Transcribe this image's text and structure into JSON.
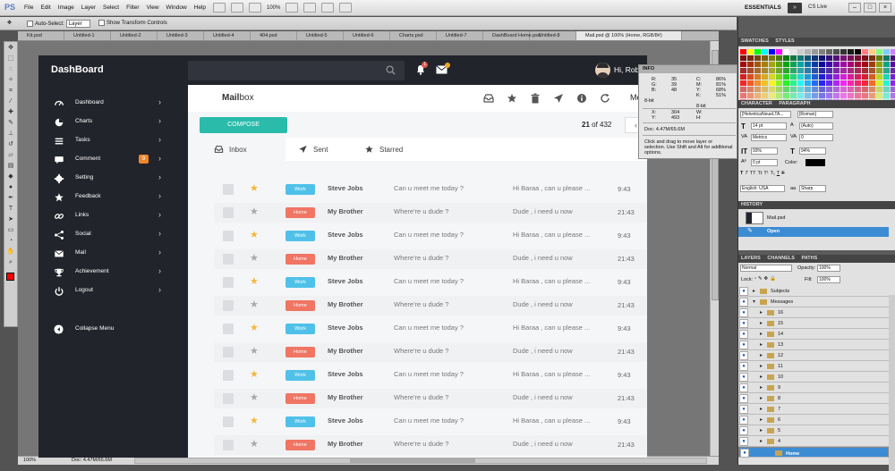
{
  "photoshop": {
    "logo": "PS",
    "menu": [
      "File",
      "Edit",
      "Image",
      "Layer",
      "Select",
      "Filter",
      "View",
      "Window",
      "Help"
    ],
    "zoom": "100%",
    "workspace": "ESSENTIALS",
    "cs_live": "CS Live",
    "options": {
      "auto_select": "Auto-Select:",
      "auto_select_value": "Layer",
      "transform": "Show Transform Controls"
    },
    "tabs": [
      "Kit.psd",
      "Untitled-1",
      "Untitled-2",
      "Untitled-3",
      "Untitled-4",
      "404.psd",
      "Untitled-5",
      "Untitled-6",
      "Charts.psd",
      "Untitled-7",
      "DashBoard Home.psd",
      "Untitled-8",
      "Mail.psd @ 100% (Home, RGB/8#)"
    ],
    "status": {
      "zoom": "100%",
      "doc": "Doc: 4.47M/65.6M"
    },
    "colors": {
      "foreground": "#ff0000",
      "background": "#ffffff",
      "accent": "#3c8cd4"
    }
  },
  "info_panel": {
    "title": "INFO",
    "rgb": [
      {
        "k": "R:",
        "v": "35"
      },
      {
        "k": "G:",
        "v": "39"
      },
      {
        "k": "B:",
        "v": "48"
      }
    ],
    "cmyk": [
      {
        "k": "C:",
        "v": "86%"
      },
      {
        "k": "M:",
        "v": "81%"
      },
      {
        "k": "Y:",
        "v": "68%"
      },
      {
        "k": "K:",
        "v": "51%"
      }
    ],
    "bit_left": "8-bit",
    "bit_right": "8-bit",
    "xy": [
      {
        "k": "X:",
        "v": "304"
      },
      {
        "k": "Y:",
        "v": "493"
      }
    ],
    "wh": [
      {
        "k": "W:",
        "v": ""
      },
      {
        "k": "H:",
        "v": ""
      }
    ],
    "doc": "Doc: 4.47M/65.6M",
    "hint": "Click and drag to move layer or selection. Use Shift and Alt for additional options."
  },
  "panels": {
    "swatches_tabs": [
      "SWATCHES",
      "STYLES"
    ],
    "character_tabs": [
      "CHARACTER",
      "PARAGRAPH"
    ],
    "font": "[HelveticaNeueLTA...",
    "font_style": "[Roman]",
    "size": "14 pt",
    "leading": "(Auto)",
    "kerning": "Metrics",
    "tracking": "0",
    "vscale": "93%",
    "hscale": "94%",
    "baseline": "0 pt",
    "color_label": "Color:",
    "language": "English: USA",
    "aa_label": "aa",
    "antialias": "Sharp",
    "history_title": "HISTORY",
    "history_doc": "Mail.psd",
    "history_step": "Open",
    "layers_tabs": [
      "LAYERS",
      "CHANNELS",
      "PATHS"
    ],
    "blend": "Normal",
    "opacity_label": "Opacity:",
    "opacity": "100%",
    "lock_label": "Lock:",
    "fill_label": "Fill:",
    "fill": "100%",
    "layers": [
      {
        "name": "Subjects",
        "indent": 0,
        "sel": false
      },
      {
        "name": "Messages",
        "indent": 0,
        "sel": false
      },
      {
        "name": "16",
        "indent": 1,
        "sel": false
      },
      {
        "name": "15",
        "indent": 1,
        "sel": false
      },
      {
        "name": "14",
        "indent": 1,
        "sel": false
      },
      {
        "name": "13",
        "indent": 1,
        "sel": false
      },
      {
        "name": "12",
        "indent": 1,
        "sel": false
      },
      {
        "name": "11",
        "indent": 1,
        "sel": false
      },
      {
        "name": "10",
        "indent": 1,
        "sel": false
      },
      {
        "name": "9",
        "indent": 1,
        "sel": false
      },
      {
        "name": "8",
        "indent": 1,
        "sel": false
      },
      {
        "name": "7",
        "indent": 1,
        "sel": false
      },
      {
        "name": "6",
        "indent": 1,
        "sel": false
      },
      {
        "name": "5",
        "indent": 1,
        "sel": false
      },
      {
        "name": "4",
        "indent": 1,
        "sel": false
      },
      {
        "name": "Home",
        "indent": 2,
        "sel": true
      }
    ]
  },
  "dashboard": {
    "logo": "DashBoard",
    "user": "Hi, Rob",
    "nav": [
      {
        "label": "Dashboard",
        "icon": "dashboard-icon",
        "badge": ""
      },
      {
        "label": "Charts",
        "icon": "charts-icon",
        "badge": ""
      },
      {
        "label": "Tasks",
        "icon": "tasks-icon",
        "badge": ""
      },
      {
        "label": "Comment",
        "icon": "comment-icon",
        "badge": "9"
      },
      {
        "label": "Setting",
        "icon": "gear-icon",
        "badge": ""
      },
      {
        "label": "Feedback",
        "icon": "star-icon",
        "badge": ""
      },
      {
        "label": "Links",
        "icon": "link-icon",
        "badge": ""
      },
      {
        "label": "Social",
        "icon": "share-icon",
        "badge": ""
      },
      {
        "label": "Mail",
        "icon": "mail-icon",
        "badge": ""
      },
      {
        "label": "Achievement",
        "icon": "trophy-icon",
        "badge": ""
      },
      {
        "label": "Logout",
        "icon": "power-icon",
        "badge": ""
      }
    ],
    "collapse": "Collapse Menu",
    "mail": {
      "title_bold": "Mail",
      "title_rest": "box",
      "compose": "COMPOSE",
      "count_current": "21",
      "count_rest": " of 432",
      "actions": [
        "inbox-icon",
        "star-icon",
        "trash-icon",
        "send-icon",
        "info-icon",
        "refresh-icon"
      ],
      "more": "Me",
      "tabs": [
        {
          "label": "Inbox",
          "icon": "inbox-icon"
        },
        {
          "label": "Sent",
          "icon": "send-icon"
        },
        {
          "label": "Starred",
          "icon": "star-icon"
        }
      ],
      "rows": [
        {
          "starred": true,
          "tag": "Work",
          "sender": "Steve Jobs",
          "subject": "Can u meet me today ?",
          "preview": "Hi Baraa , can u please ...",
          "time": "9:43"
        },
        {
          "starred": false,
          "tag": "Home",
          "sender": "My Brother",
          "subject": "Where're u dude ?",
          "preview": "Dude , i need u now",
          "time": "21:43"
        },
        {
          "starred": true,
          "tag": "Work",
          "sender": "Steve Jobs",
          "subject": "Can u meet me today ?",
          "preview": "Hi Baraa , can u please ...",
          "time": "9:43"
        },
        {
          "starred": false,
          "tag": "Home",
          "sender": "My Brother",
          "subject": "Where're u dude ?",
          "preview": "Dude , i need u now",
          "time": "21:43"
        },
        {
          "starred": true,
          "tag": "Work",
          "sender": "Steve Jobs",
          "subject": "Can u meet me today ?",
          "preview": "Hi Baraa , can u please ...",
          "time": "9:43"
        },
        {
          "starred": false,
          "tag": "Home",
          "sender": "My Brother",
          "subject": "Where're u dude ?",
          "preview": "Dude , i need u now",
          "time": "21:43"
        },
        {
          "starred": true,
          "tag": "Work",
          "sender": "Steve Jobs",
          "subject": "Can u meet me today ?",
          "preview": "Hi Baraa , can u please ...",
          "time": "9:43"
        },
        {
          "starred": false,
          "tag": "Home",
          "sender": "My Brother",
          "subject": "Where're u dude ?",
          "preview": "Dude , i need u now",
          "time": "21:43"
        },
        {
          "starred": true,
          "tag": "Work",
          "sender": "Steve Jobs",
          "subject": "Can u meet me today ?",
          "preview": "Hi Baraa , can u please ...",
          "time": "9:43"
        },
        {
          "starred": false,
          "tag": "Home",
          "sender": "My Brother",
          "subject": "Where're u dude ?",
          "preview": "Dude , i need u now",
          "time": "21:43"
        },
        {
          "starred": true,
          "tag": "Work",
          "sender": "Steve Jobs",
          "subject": "Can u meet me today ?",
          "preview": "Hi Baraa , can u please ...",
          "time": "9:43"
        },
        {
          "starred": false,
          "tag": "Home",
          "sender": "My Brother",
          "subject": "Where're u dude ?",
          "preview": "Dude , i need u now",
          "time": "21:43"
        }
      ]
    },
    "colors": {
      "sidebar": "#22242b",
      "compose": "#2bbbab",
      "work_tag": "#4fc1e9",
      "home_tag": "#f07563",
      "star_on": "#f5b73a",
      "star_off": "#a7a9ad",
      "badge": "#f0862a"
    }
  }
}
